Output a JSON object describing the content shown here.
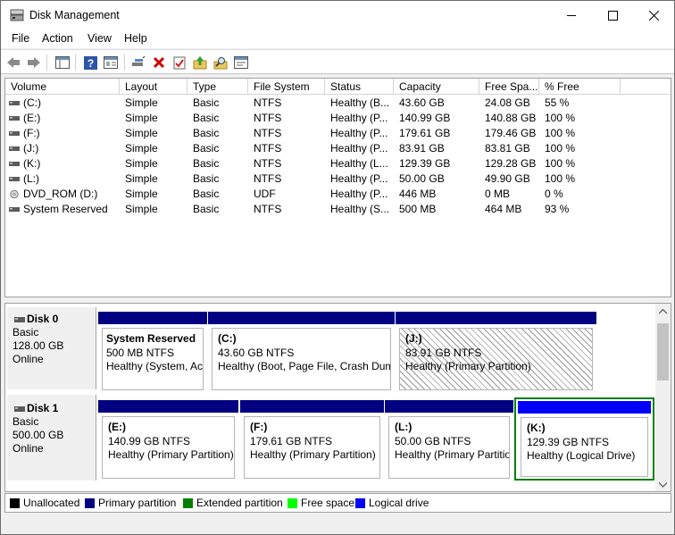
{
  "window": {
    "title": "Disk Management"
  },
  "menu": [
    "File",
    "Action",
    "View",
    "Help"
  ],
  "toolbar": {
    "icons": [
      "back-arrow-icon",
      "forward-arrow-icon",
      "console-tree-icon",
      "help-icon",
      "properties-icon",
      "connect-icon",
      "delete-icon",
      "check-icon",
      "export-icon",
      "search-icon",
      "rescan-icon"
    ]
  },
  "volume_list": {
    "columns": [
      "Volume",
      "Layout",
      "Type",
      "File System",
      "Status",
      "Capacity",
      "Free Spa...",
      "% Free"
    ],
    "rows": [
      [
        "(C:)",
        "Simple",
        "Basic",
        "NTFS",
        "Healthy (B...",
        "43.60 GB",
        "24.08 GB",
        "55 %"
      ],
      [
        "(E:)",
        "Simple",
        "Basic",
        "NTFS",
        "Healthy (P...",
        "140.99 GB",
        "140.88 GB",
        "100 %"
      ],
      [
        "(F:)",
        "Simple",
        "Basic",
        "NTFS",
        "Healthy (P...",
        "179.61 GB",
        "179.46 GB",
        "100 %"
      ],
      [
        "(J:)",
        "Simple",
        "Basic",
        "NTFS",
        "Healthy (P...",
        "83.91 GB",
        "83.81 GB",
        "100 %"
      ],
      [
        "(K:)",
        "Simple",
        "Basic",
        "NTFS",
        "Healthy (L...",
        "129.39 GB",
        "129.28 GB",
        "100 %"
      ],
      [
        "(L:)",
        "Simple",
        "Basic",
        "NTFS",
        "Healthy (P...",
        "50.00 GB",
        "49.90 GB",
        "100 %"
      ],
      [
        "DVD_ROM (D:)",
        "Simple",
        "Basic",
        "UDF",
        "Healthy (P...",
        "446 MB",
        "0 MB",
        "0 %"
      ],
      [
        "System Reserved",
        "Simple",
        "Basic",
        "NTFS",
        "Healthy (S...",
        "500 MB",
        "464 MB",
        "93 %"
      ]
    ],
    "row_icons": [
      "drive-icon",
      "drive-icon",
      "drive-icon",
      "drive-icon",
      "drive-icon",
      "drive-icon",
      "dvd-icon",
      "drive-icon"
    ]
  },
  "disks": [
    {
      "name": "Disk 0",
      "type": "Basic",
      "size": "128.00 GB",
      "status": "Online",
      "partitions": [
        {
          "name": "System Reserved",
          "size": "500 MB NTFS",
          "status": "Healthy (System, Ac"
        },
        {
          "name": "(C:)",
          "size": "43.60 GB NTFS",
          "status": "Healthy (Boot, Page File, Crash Dump"
        },
        {
          "name": "(J:)",
          "size": "83.91 GB NTFS",
          "status": "Healthy (Primary Partition)"
        }
      ]
    },
    {
      "name": "Disk 1",
      "type": "Basic",
      "size": "500.00 GB",
      "status": "Online",
      "partitions": [
        {
          "name": "(E:)",
          "size": "140.99 GB NTFS",
          "status": "Healthy (Primary Partition)"
        },
        {
          "name": "(F:)",
          "size": "179.61 GB NTFS",
          "status": "Healthy (Primary Partition)"
        },
        {
          "name": "(L:)",
          "size": "50.00 GB NTFS",
          "status": "Healthy (Primary Partitio"
        },
        {
          "name": "(K:)",
          "size": "129.39 GB NTFS",
          "status": "Healthy (Logical Drive)"
        }
      ]
    }
  ],
  "legend": [
    "Unallocated",
    "Primary partition",
    "Extended partition",
    "Free space",
    "Logical drive"
  ],
  "colors": {
    "primary": "#000080",
    "logical": "#0000ff",
    "extended": "#008000",
    "free": "#00ff00",
    "unallocated": "#000000"
  }
}
